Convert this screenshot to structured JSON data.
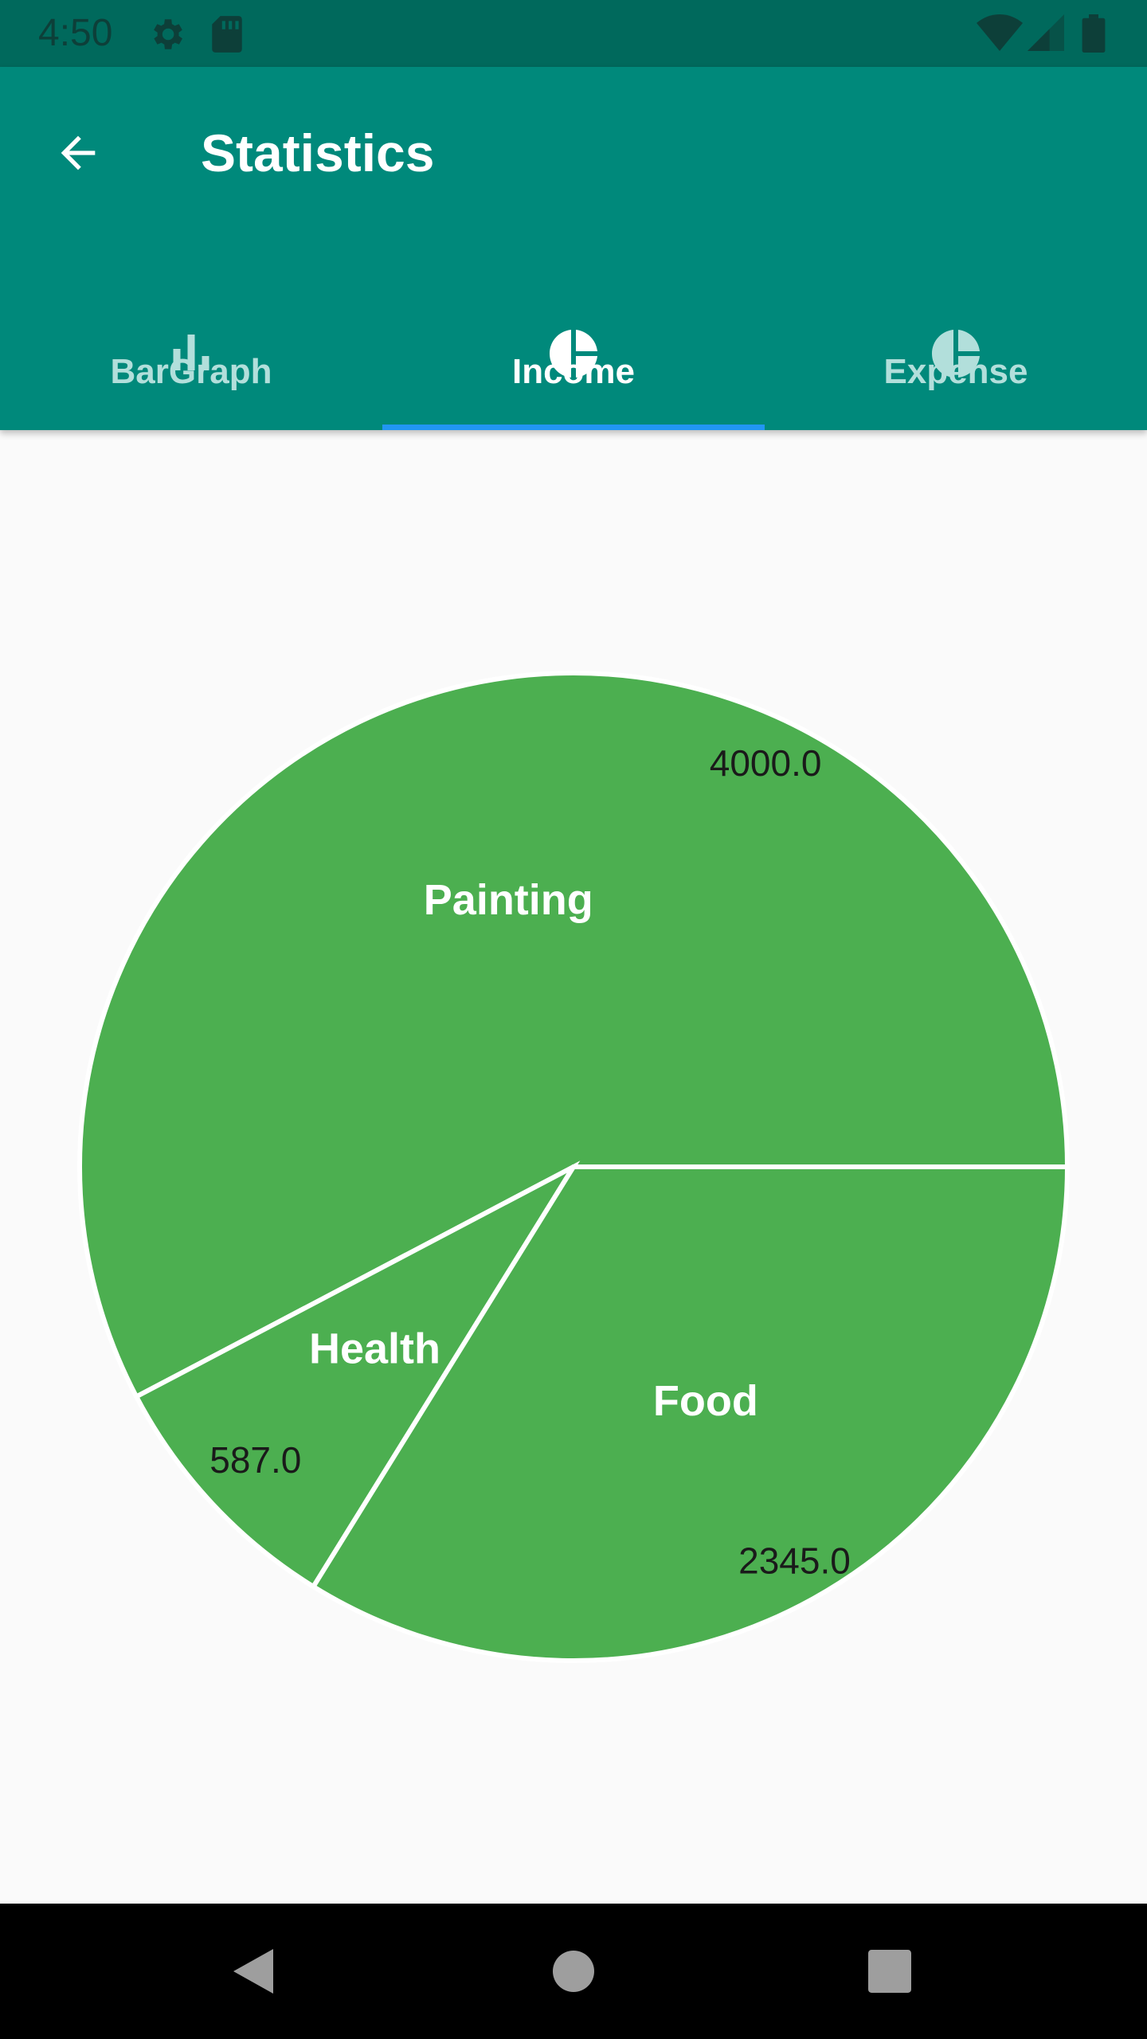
{
  "status_bar": {
    "time": "4:50",
    "icons": [
      "gear-icon",
      "sd-card-icon",
      "wifi-icon",
      "signal-icon",
      "battery-icon"
    ]
  },
  "app_bar": {
    "title": "Statistics",
    "back_icon": "arrow-back-icon",
    "background": "#00897b"
  },
  "tabs": [
    {
      "label": "BarGraph",
      "icon": "bar-chart-icon",
      "selected": false
    },
    {
      "label": "Income",
      "icon": "pie-chart-icon",
      "selected": true
    },
    {
      "label": "Expense",
      "icon": "pie-chart-icon",
      "selected": false
    }
  ],
  "colors": {
    "accent": "#2196f3",
    "tab_active": "#ffffff",
    "tab_inactive": "#b2dfdb",
    "slice": "#4caf50"
  },
  "chart_data": {
    "type": "pie",
    "categories": [
      "Painting",
      "Food",
      "Health"
    ],
    "values": [
      4000.0,
      2345.0,
      587.0
    ],
    "value_labels": [
      "4000.0",
      "2345.0",
      "587.0"
    ],
    "color": "#4caf50"
  },
  "nav_bar": {
    "buttons": [
      "back-triangle-icon",
      "home-circle-icon",
      "recents-square-icon"
    ]
  }
}
